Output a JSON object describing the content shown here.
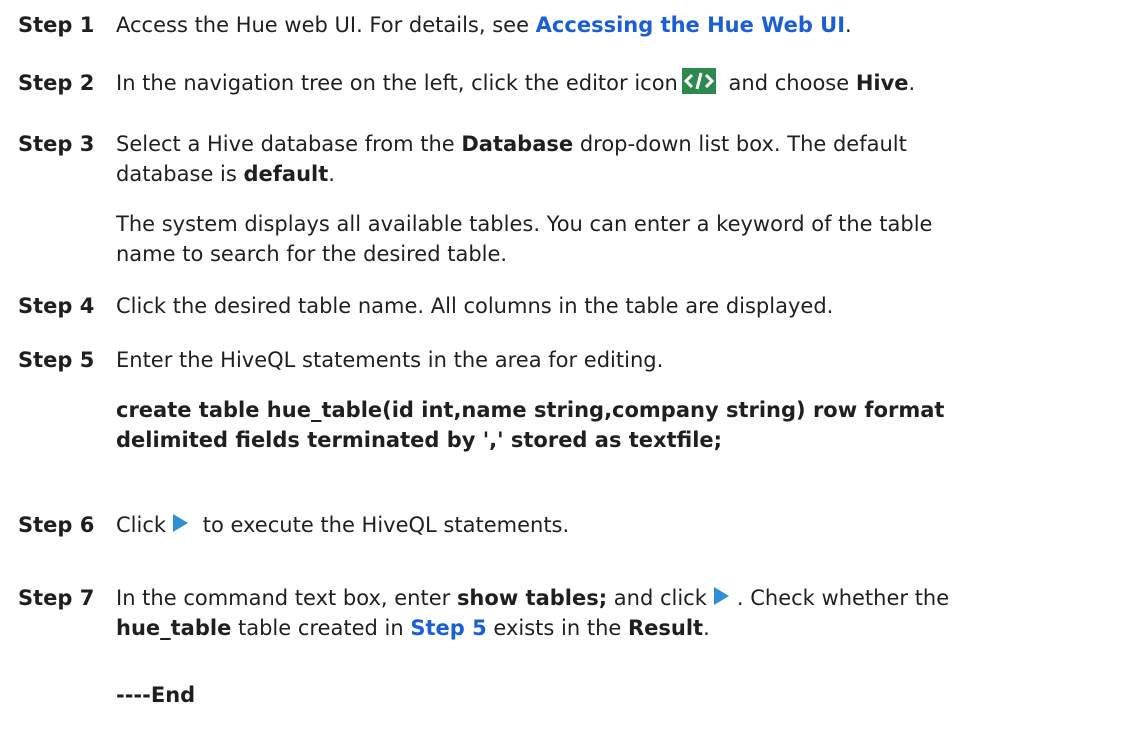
{
  "steps": [
    {
      "label": "Step 1",
      "text_a": "Access the Hue web UI. For details, see ",
      "link": "Accessing the Hue Web UI",
      "text_b": "."
    },
    {
      "label": "Step 2",
      "text_a": "In the navigation tree on the left, click the editor icon",
      "text_b": " and choose ",
      "bold": "Hive",
      "text_c": "."
    },
    {
      "label": "Step 3",
      "line1_a": "Select a Hive database from the ",
      "line1_bold": "Database",
      "line1_b": " drop-down list box. The default",
      "line2_a": "database is ",
      "line2_bold": "default",
      "line2_b": ".",
      "para_line1": "The system displays all available tables. You can enter a keyword of the table",
      "para_line2": "name to search for the desired table."
    },
    {
      "label": "Step 4",
      "text": "Click the desired table name. All columns in the table are displayed."
    },
    {
      "label": "Step 5",
      "text": "Enter the HiveQL statements in the area for editing.",
      "code_line1": "create table hue_table(id int,name string,company string) row format",
      "code_line2": "delimited fields terminated by ',' stored as textfile;"
    },
    {
      "label": "Step 6",
      "text_a": "Click",
      "text_b": " to execute the HiveQL statements."
    },
    {
      "label": "Step 7",
      "line1_a": "In the command text box, enter ",
      "line1_bold": "show tables;",
      "line1_b": " and click",
      "line1_c": ". Check whether the",
      "line2_bold1": "hue_table",
      "line2_a": " table created in ",
      "line2_link": "Step 5",
      "line2_b": " exists in the ",
      "line2_bold2": "Result",
      "line2_c": "."
    }
  ],
  "end_marker": "----End",
  "icons": {
    "editor": "code-editor-icon",
    "run": "execute-icon"
  },
  "colors": {
    "link": "#1a5fd6",
    "editor_icon_bg": "#2c8a4f",
    "run_icon": "#2f8fd6"
  }
}
